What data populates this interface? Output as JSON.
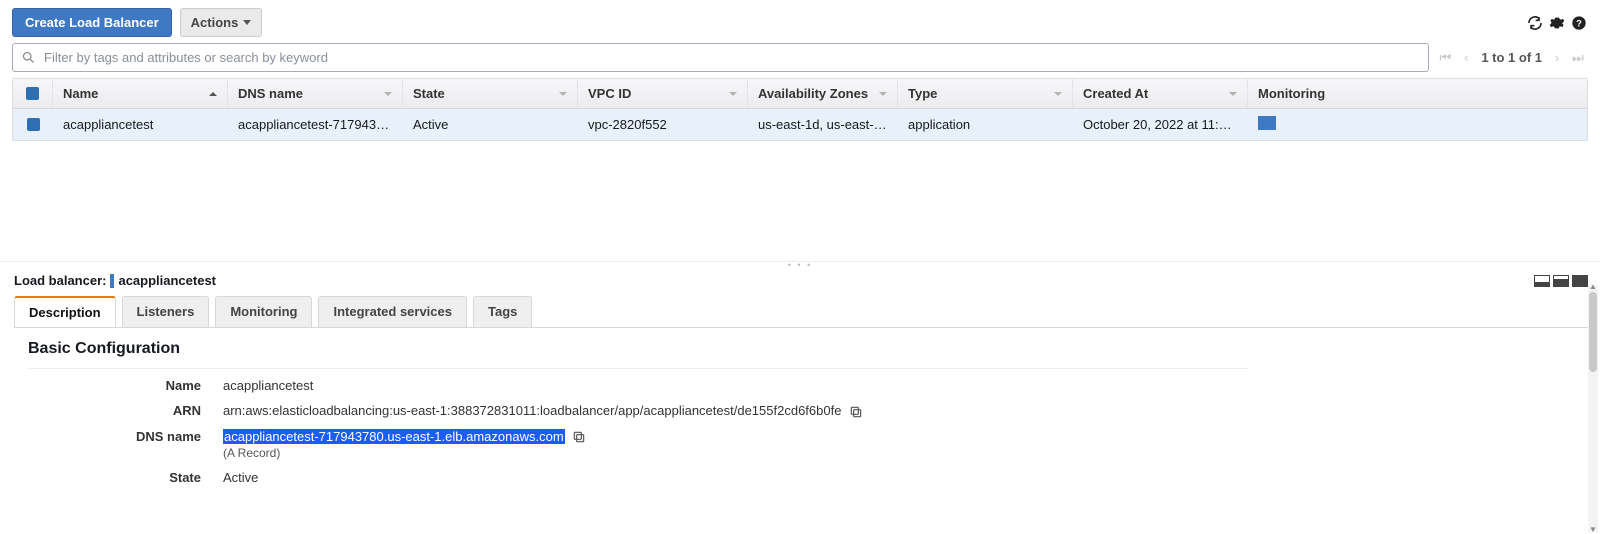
{
  "toolbar": {
    "create_label": "Create Load Balancer",
    "actions_label": "Actions"
  },
  "filter": {
    "placeholder": "Filter by tags and attributes or search by keyword"
  },
  "pager": {
    "text": "1 to 1 of 1"
  },
  "columns": {
    "name": "Name",
    "dns": "DNS name",
    "state": "State",
    "vpc": "VPC ID",
    "az": "Availability Zones",
    "type": "Type",
    "created": "Created At",
    "monitoring": "Monitoring"
  },
  "rows": [
    {
      "name": "acappliancetest",
      "dns": "acappliancetest-717943780.…",
      "state": "Active",
      "vpc": "vpc-2820f552",
      "az": "us-east-1d, us-east-1c, …",
      "type": "application",
      "created": "October 20, 2022 at 11:03:3…"
    }
  ],
  "detail": {
    "header_prefix": "Load balancer:",
    "header_name": "acappliancetest",
    "tabs": {
      "description": "Description",
      "listeners": "Listeners",
      "monitoring": "Monitoring",
      "integrated": "Integrated services",
      "tags": "Tags"
    },
    "section_title": "Basic Configuration",
    "fields": {
      "name_label": "Name",
      "name_value": "acappliancetest",
      "arn_label": "ARN",
      "arn_value": "arn:aws:elasticloadbalancing:us-east-1:388372831011:loadbalancer/app/acappliancetest/de155f2cd6f6b0fe",
      "dns_label": "DNS name",
      "dns_value": "acappliancetest-717943780.us-east-1.elb.amazonaws.com",
      "dns_sub": "(A Record)",
      "state_label": "State",
      "state_value": "Active"
    }
  }
}
